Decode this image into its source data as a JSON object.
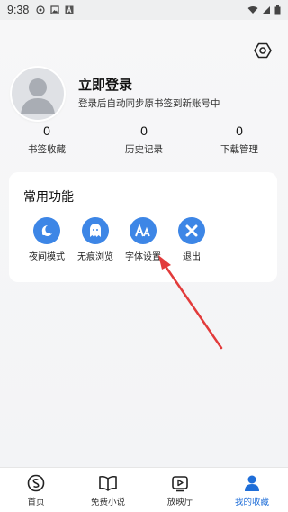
{
  "status_bar": {
    "time": "9:38"
  },
  "profile": {
    "title": "立即登录",
    "subtitle": "登录后自动同步原书签到新账号中"
  },
  "stats": [
    {
      "value": "0",
      "label": "书签收藏"
    },
    {
      "value": "0",
      "label": "历史记录"
    },
    {
      "value": "0",
      "label": "下载管理"
    }
  ],
  "functions": {
    "title": "常用功能",
    "items": [
      {
        "label": "夜间模式",
        "icon": "night-mode-icon"
      },
      {
        "label": "无痕浏览",
        "icon": "ghost-icon"
      },
      {
        "label": "字体设置",
        "icon": "font-icon"
      },
      {
        "label": "退出",
        "icon": "close-icon"
      }
    ]
  },
  "tabs": [
    {
      "label": "首页",
      "icon": "home-icon"
    },
    {
      "label": "免费小说",
      "icon": "book-icon"
    },
    {
      "label": "放映厅",
      "icon": "play-icon"
    },
    {
      "label": "我的收藏",
      "icon": "user-icon",
      "active": true
    }
  ],
  "colors": {
    "accent": "#3d86e6",
    "active_tab": "#1f6ed8",
    "arrow": "#e23b3b"
  }
}
